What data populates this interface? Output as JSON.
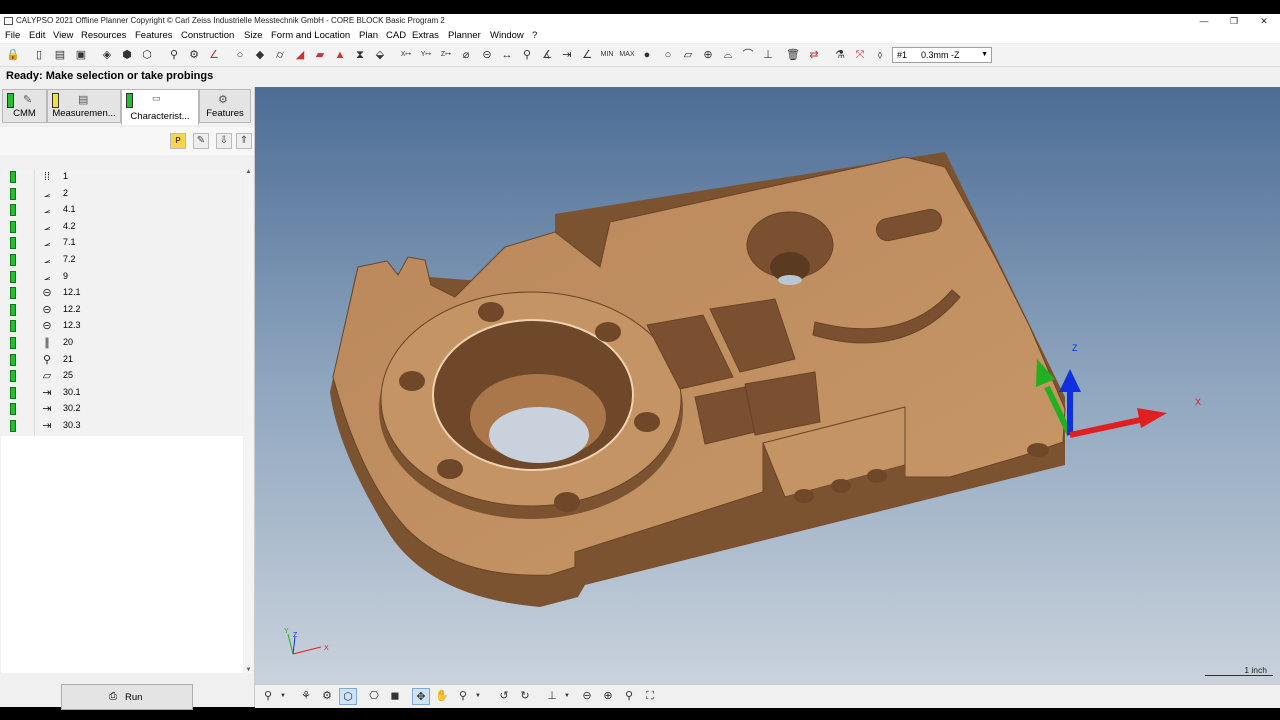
{
  "window": {
    "title": "CALYPSO 2021 Offline Planner Copyright © Carl Zeiss Industrielle Messtechnik GmbH - CORE BLOCK Basic Program 2",
    "minimize_icon": "minimize-icon",
    "restore_icon": "restore-icon",
    "close_icon": "close-icon"
  },
  "menubar": {
    "items": [
      "File",
      "Edit",
      "View",
      "Resources",
      "Features",
      "Construction",
      "Size",
      "Form and Location",
      "Plan",
      "CAD",
      "Extras",
      "Planner",
      "Window",
      "?"
    ]
  },
  "toolbar": {
    "axis_labels": [
      "X",
      "Y",
      "Z",
      "MIN",
      "MAX"
    ],
    "probe_combo": {
      "probe": "#1",
      "stylus": "0.3mm -Z"
    }
  },
  "status": {
    "text": "Ready: Make selection or take probings"
  },
  "tabs": [
    {
      "label": "CMM",
      "status_color": "#22c030",
      "icon": "wrench-icon"
    },
    {
      "label": "Measuremen...",
      "status_color": "#f2e23a",
      "icon": "list-icon"
    },
    {
      "label": "Characterist...",
      "status_color": "#22c030",
      "icon": "characteristic-icon",
      "active": true
    },
    {
      "label": "Features",
      "status_color": "",
      "icon": "features-icon"
    }
  ],
  "list_toolbar": {
    "p_label": "P"
  },
  "characteristics": [
    {
      "name": "1",
      "icon": "distance-icon"
    },
    {
      "name": "2",
      "icon": "angle-icon"
    },
    {
      "name": "4.1",
      "icon": "angle-icon"
    },
    {
      "name": "4.2",
      "icon": "angle-icon"
    },
    {
      "name": "7.1",
      "icon": "angle-icon"
    },
    {
      "name": "7.2",
      "icon": "angle-icon"
    },
    {
      "name": "9",
      "icon": "angle-icon"
    },
    {
      "name": "12.1",
      "icon": "circle-diameter-icon"
    },
    {
      "name": "12.2",
      "icon": "circle-diameter-icon"
    },
    {
      "name": "12.3",
      "icon": "circle-diameter-icon"
    },
    {
      "name": "20",
      "icon": "parallelism-icon"
    },
    {
      "name": "21",
      "icon": "position-icon"
    },
    {
      "name": "25",
      "icon": "flatness-icon"
    },
    {
      "name": "30.1",
      "icon": "z-distance-icon"
    },
    {
      "name": "30.2",
      "icon": "z-distance-icon"
    },
    {
      "name": "30.3",
      "icon": "z-distance-icon"
    }
  ],
  "run_button": {
    "label": "Run"
  },
  "viewport": {
    "axis_labels": {
      "x": "X",
      "y": "Y",
      "z": "Z"
    },
    "scale_label": "1 inch",
    "part_color": "#c49060",
    "axis_colors": {
      "x": "#e02020",
      "y": "#20b020",
      "z": "#1030e0"
    }
  }
}
